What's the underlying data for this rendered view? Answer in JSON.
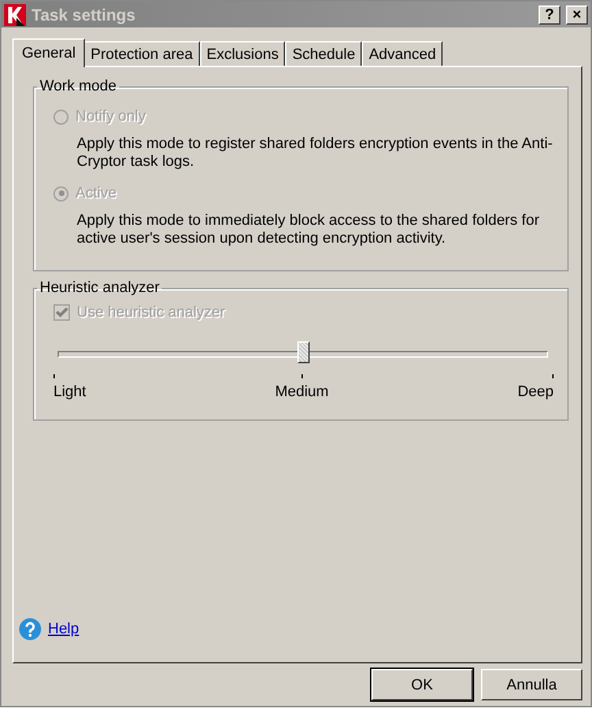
{
  "window": {
    "title": "Task settings",
    "title_buttons": [
      "?",
      "×"
    ]
  },
  "tabs": [
    {
      "label": "General",
      "selected": true
    },
    {
      "label": "Protection area",
      "selected": false
    },
    {
      "label": "Exclusions",
      "selected": false
    },
    {
      "label": "Schedule",
      "selected": false
    },
    {
      "label": "Advanced",
      "selected": false
    }
  ],
  "work_mode": {
    "title": "Work mode",
    "options": [
      {
        "label": "Notify only",
        "selected": false,
        "disabled": true,
        "description": "Apply this mode to register shared folders encryption events in the Anti-Cryptor task logs."
      },
      {
        "label": "Active",
        "selected": true,
        "disabled": true,
        "description": "Apply this mode to immediately block access to the shared folders for active user's session upon detecting encryption activity."
      }
    ]
  },
  "heuristic_analyzer": {
    "title": "Heuristic analyzer",
    "checkbox": {
      "label": "Use heuristic analyzer",
      "checked": true,
      "disabled": true
    },
    "slider": {
      "level": 0.5,
      "labels": [
        "Light",
        "Medium",
        "Deep"
      ]
    }
  },
  "help_link": "Help",
  "buttons": [
    "OK",
    "Annulla"
  ]
}
